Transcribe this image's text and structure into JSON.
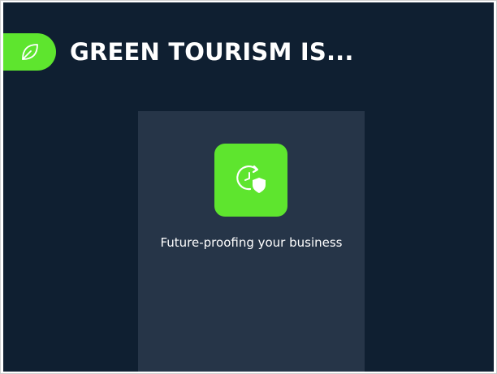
{
  "slide": {
    "title": "GREEN TOURISM IS...",
    "title_icon": "leaf-icon",
    "card": {
      "icon": "clock-shield-icon",
      "text": "Future-proofing your business"
    }
  },
  "colors": {
    "background": "#0f1f31",
    "card": "#263548",
    "accent": "#5ee52e",
    "text": "#ffffff"
  }
}
